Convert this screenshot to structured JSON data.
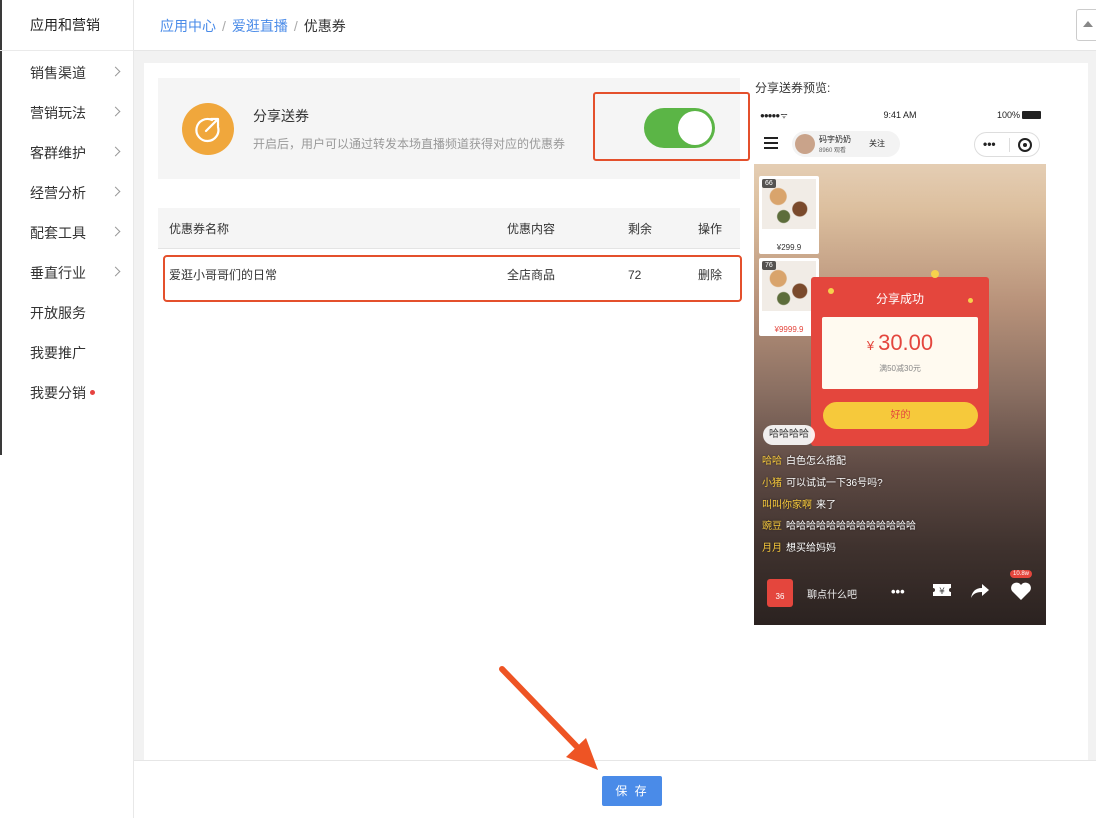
{
  "sidebar": {
    "title": "应用和营销",
    "items": [
      {
        "label": "销售渠道"
      },
      {
        "label": "营销玩法"
      },
      {
        "label": "客群维护"
      },
      {
        "label": "经营分析"
      },
      {
        "label": "配套工具"
      },
      {
        "label": "垂直行业"
      },
      {
        "label": "开放服务"
      },
      {
        "label": "我要推广"
      },
      {
        "label": "我要分销"
      }
    ]
  },
  "breadcrumb": {
    "items": [
      "应用中心",
      "爱逛直播",
      "优惠券"
    ],
    "separator": "/"
  },
  "share": {
    "title": "分享送券",
    "description": "开启后，用户可以通过转发本场直播频道获得对应的优惠券",
    "enabled": true
  },
  "table": {
    "headers": [
      "优惠券名称",
      "优惠内容",
      "剩余",
      "操作"
    ],
    "rows": [
      {
        "name": "爱逛小哥哥们的日常",
        "content": "全店商品",
        "remaining": "72",
        "action": "删除"
      }
    ]
  },
  "preview": {
    "label": "分享送券预览:",
    "status": {
      "signal": "●●●●● ᯤ",
      "time": "9:41 AM",
      "battery": "100%"
    },
    "host": {
      "name": "码字奶奶",
      "views": "8960 观看",
      "follow": "关注"
    },
    "products": [
      {
        "badge": "66",
        "price": "¥299.9"
      },
      {
        "badge": "76",
        "price": "¥9999.9"
      }
    ],
    "popup": {
      "title": "分享成功",
      "currency": "¥",
      "amount": "30.00",
      "condition": "满50减30元",
      "ok": "好的"
    },
    "chat": {
      "bubble": "哈哈哈哈",
      "lines": [
        {
          "user": "哈哈",
          "text": "白色怎么搭配"
        },
        {
          "user": "小猪",
          "text": "可以试试一下36号吗?"
        },
        {
          "user": "叫叫你家啊",
          "text": "来了"
        },
        {
          "user": "豌豆",
          "text": "哈哈哈哈哈哈哈哈哈哈哈哈哈"
        },
        {
          "user": "月月",
          "text": "想买给妈妈"
        }
      ]
    },
    "bottom": {
      "bag_count": "36",
      "placeholder": "聊点什么吧",
      "likes": "10.8w"
    }
  },
  "save_button": "保 存",
  "colors": {
    "accent": "#4a8be8",
    "highlight": "#e4502c",
    "toggle_on": "#5bb546",
    "icon_bg": "#f0a73c",
    "popup": "#e4463d"
  }
}
